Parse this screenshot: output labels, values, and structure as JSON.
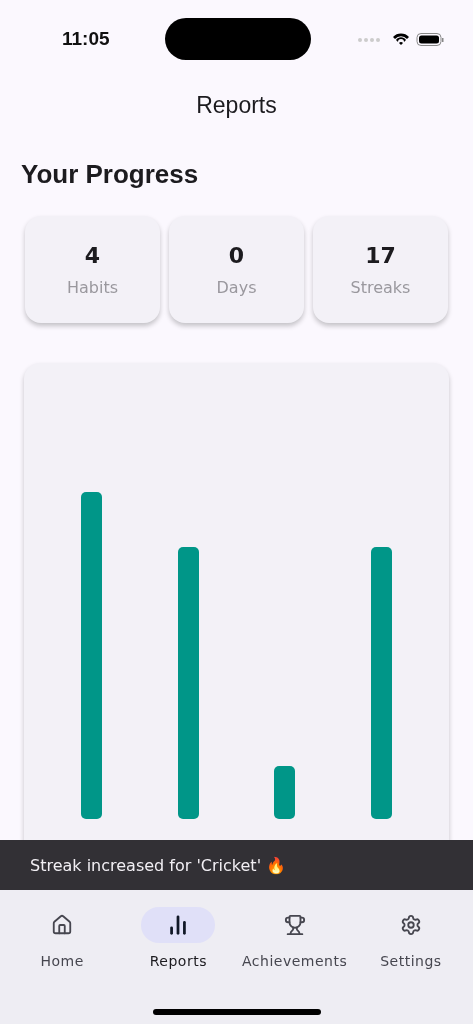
{
  "status_bar": {
    "time": "11:05"
  },
  "header": {
    "title": "Reports"
  },
  "section_title": "Your Progress",
  "stats": [
    {
      "value": "4",
      "label": "Habits"
    },
    {
      "value": "0",
      "label": "Days"
    },
    {
      "value": "17",
      "label": "Streaks"
    }
  ],
  "snackbar": {
    "message": "Streak increased for 'Cricket' 🔥"
  },
  "nav": [
    {
      "label": "Home",
      "selected": false
    },
    {
      "label": "Reports",
      "selected": true
    },
    {
      "label": "Achievements",
      "selected": false
    },
    {
      "label": "Settings",
      "selected": false
    }
  ]
}
